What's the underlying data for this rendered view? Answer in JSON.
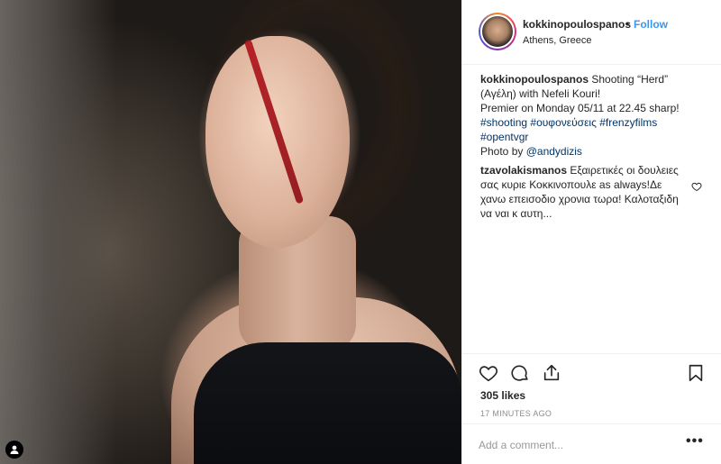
{
  "post": {
    "username": "kokkinopoulospanos",
    "separator": "•",
    "follow_label": "Follow",
    "location": "Athens, Greece"
  },
  "caption": {
    "username": "kokkinopoulospanos",
    "text_1": "Shooting “Herd” (Αγέλη) with Nefeli Kouri!",
    "text_2": "Premier on Monday 05/11 at 22.45 sharp!",
    "hashtags": [
      "#shooting",
      "#ουφονεύσεις",
      "#frenzyfilms",
      "#opentvgr"
    ],
    "photo_by_label": "Photo by",
    "photo_by_mention": "@andydizis"
  },
  "comment": {
    "username": "tzavolakismanos",
    "text": "Εξαιρετικές οι δουλειες σας κυριε Κοκκινοπουλε as always!Δε χανω επεισοδιο χρονια τωρα! Καλοταξιδη να ναι κ αυτη..."
  },
  "stats": {
    "likes": "305 likes",
    "time": "17 MINUTES AGO"
  },
  "add_comment": {
    "placeholder": "Add a comment...",
    "more": "•••"
  },
  "icons": {
    "like": "heart-icon",
    "comment": "comment-icon",
    "share": "share-icon",
    "save": "bookmark-icon",
    "tag": "user-tag-icon"
  },
  "colors": {
    "link": "#3897f0",
    "hashtag": "#003569",
    "muted": "#8e8e8e",
    "border": "#efefef"
  }
}
